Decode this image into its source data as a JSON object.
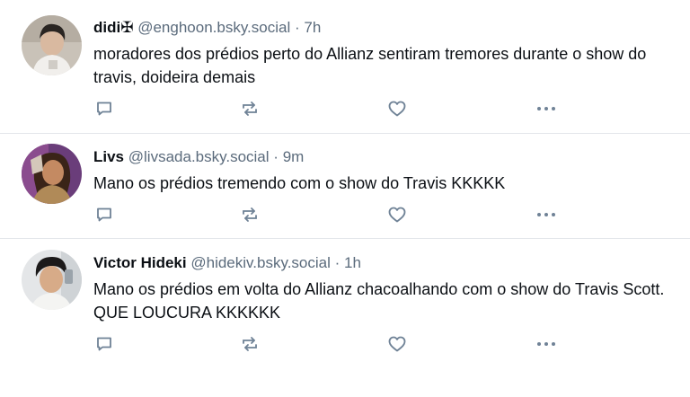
{
  "posts": [
    {
      "name": "didi✠",
      "handle": "@enghoon.bsky.social",
      "separator": "·",
      "time": "7h",
      "text": "moradores dos prédios perto do Allianz sentiram tremores durante o show do travis, doideira demais"
    },
    {
      "name": "Livs",
      "handle": "@livsada.bsky.social",
      "separator": "·",
      "time": "9m",
      "text": "Mano os prédios tremendo com o show do Travis KKKKK"
    },
    {
      "name": "Victor Hideki",
      "handle": "@hidekiv.bsky.social",
      "separator": "·",
      "time": "1h",
      "text": "Mano os prédios em volta do Allianz chacoalhando com o show do Travis Scott. QUE LOUCURA KKKKKK"
    }
  ],
  "icons": {
    "reply": "reply-bubble-icon",
    "repost": "repost-arrows-icon",
    "like": "heart-icon",
    "more": "more-dots-icon"
  },
  "colors": {
    "text": "#0b0f14",
    "muted": "#5b6b7c",
    "icon": "#6f8296",
    "divider": "#e3e6ea"
  }
}
